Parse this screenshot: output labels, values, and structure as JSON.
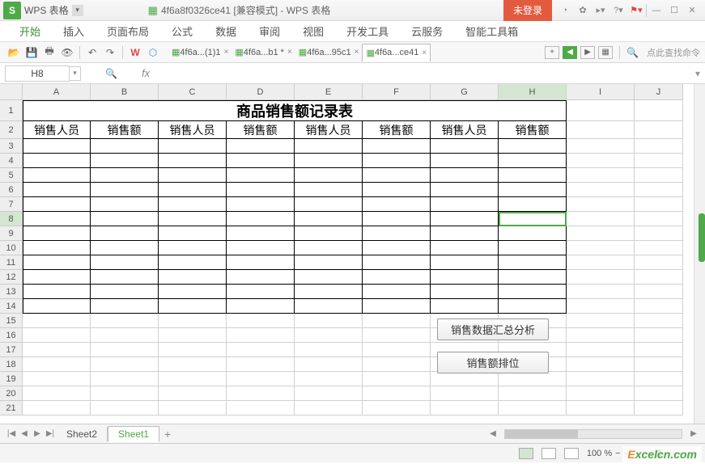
{
  "app": {
    "logo": "S",
    "name": "WPS 表格",
    "doc_title": "4f6a8f0326ce41 [兼容模式] - WPS 表格",
    "login": "未登录"
  },
  "menu": {
    "items": [
      "开始",
      "插入",
      "页面布局",
      "公式",
      "数据",
      "审阅",
      "视图",
      "开发工具",
      "云服务",
      "智能工具箱"
    ],
    "active": 0
  },
  "doctabs": {
    "items": [
      {
        "label": "4f6a...(1)1",
        "active": false
      },
      {
        "label": "4f6a...b1 *",
        "active": false
      },
      {
        "label": "4f6a...95c1",
        "active": false
      },
      {
        "label": "4f6a...ce41",
        "active": true
      }
    ],
    "search_hint": "点此查找命令"
  },
  "formula": {
    "cell_ref": "H8",
    "fx": "fx",
    "value": ""
  },
  "sheet": {
    "columns": [
      "A",
      "B",
      "C",
      "D",
      "E",
      "F",
      "G",
      "H",
      "I",
      "J"
    ],
    "sel_col": "H",
    "rows": [
      1,
      2,
      3,
      4,
      5,
      6,
      7,
      8,
      9,
      10,
      11,
      12,
      13,
      14,
      15,
      16,
      17,
      18,
      19,
      20,
      21
    ],
    "sel_row": 8,
    "title": "商品销售额记录表",
    "headers": [
      "销售人员",
      "销售额",
      "销售人员",
      "销售额",
      "销售人员",
      "销售额",
      "销售人员",
      "销售额"
    ],
    "btn1": "销售数据汇总分析",
    "btn2": "销售额排位"
  },
  "tabs": {
    "items": [
      "Sheet2",
      "Sheet1"
    ],
    "active": 1,
    "add": "+"
  },
  "status": {
    "zoom": "100 %"
  },
  "watermark": {
    "e": "E",
    "rest": "xcelcn.com"
  }
}
